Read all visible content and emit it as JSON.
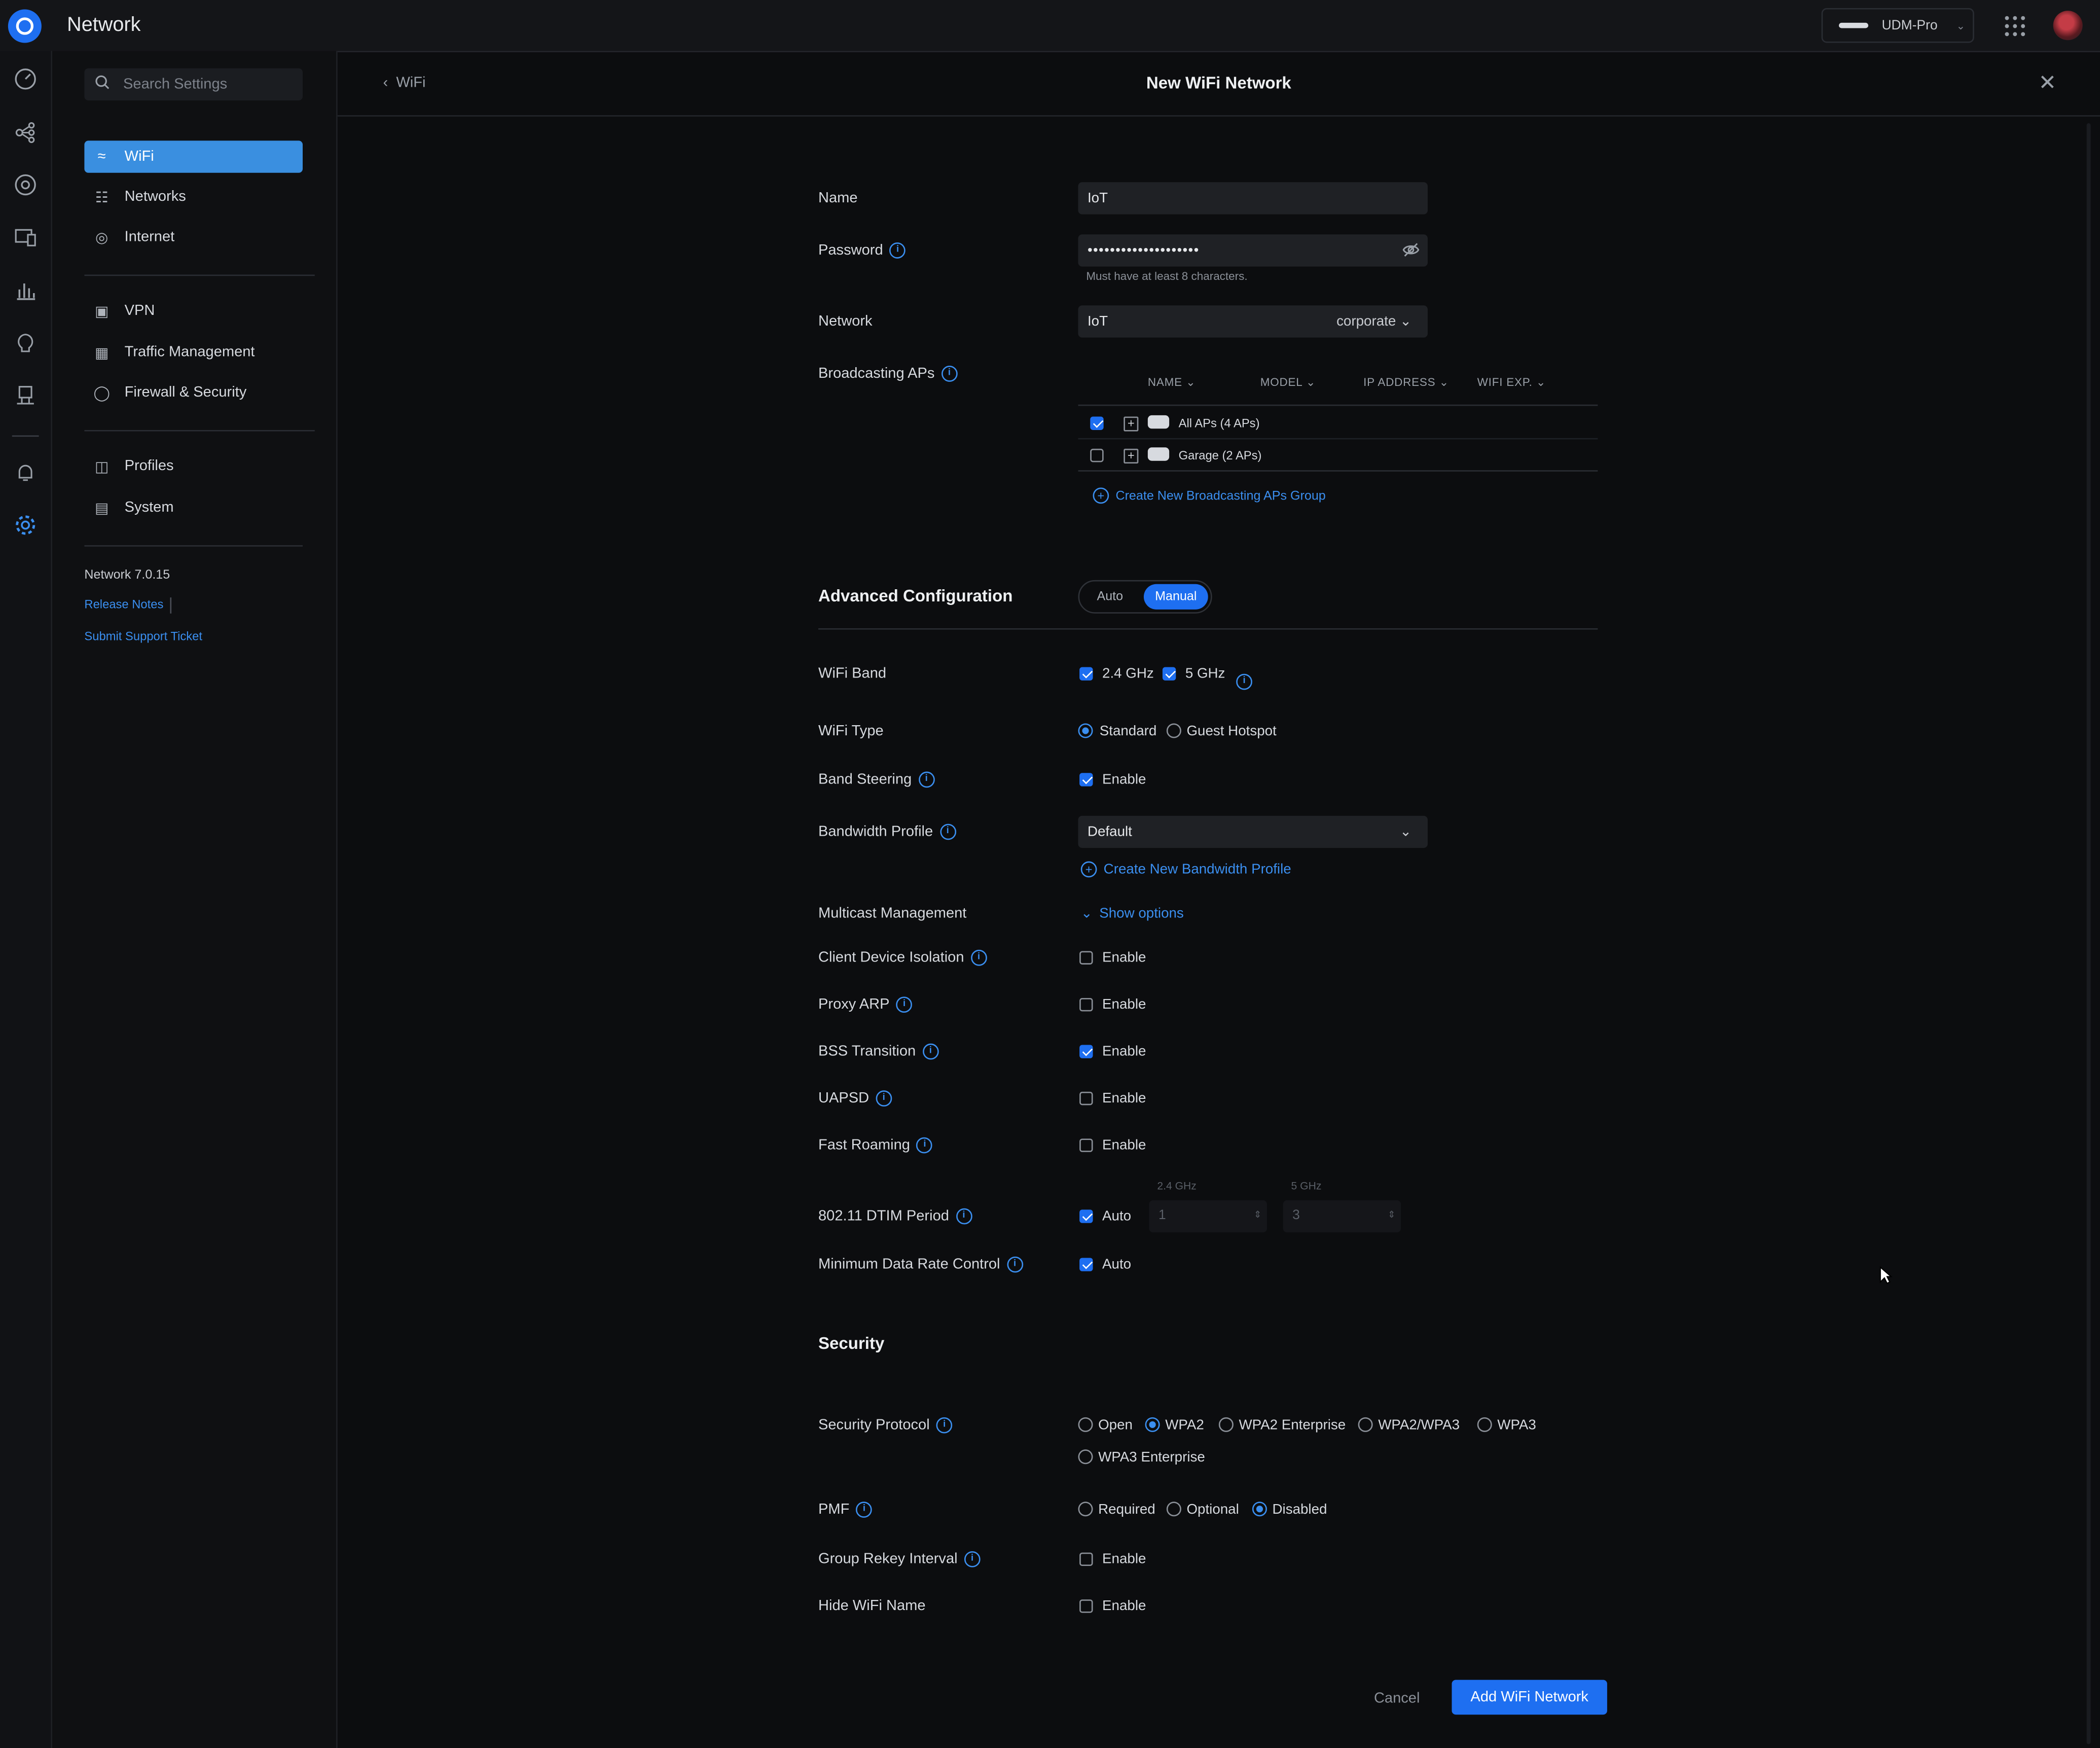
{
  "app": {
    "title": "Network"
  },
  "topbar": {
    "device": "UDM-Pro"
  },
  "sidebar": {
    "search_placeholder": "Search Settings",
    "items": [
      {
        "label": "WiFi"
      },
      {
        "label": "Networks"
      },
      {
        "label": "Internet"
      },
      {
        "label": "VPN"
      },
      {
        "label": "Traffic Management"
      },
      {
        "label": "Firewall & Security"
      },
      {
        "label": "Profiles"
      },
      {
        "label": "System"
      }
    ],
    "version": "Network 7.0.15",
    "release_notes": "Release Notes",
    "support": "Submit Support Ticket"
  },
  "header": {
    "back": "WiFi",
    "title": "New WiFi Network"
  },
  "form": {
    "name_label": "Name",
    "name_value": "IoT",
    "password_label": "Password",
    "password_value": "••••••••••••••••••••",
    "password_hint": "Must have at least 8 characters.",
    "network_label": "Network",
    "network_value": "IoT",
    "network_tag": "corporate",
    "broadcasting_label": "Broadcasting APs",
    "ap_table": {
      "headers": [
        "NAME",
        "MODEL",
        "IP ADDRESS",
        "WIFI EXP."
      ],
      "rows": [
        {
          "name": "All APs (4 APs)",
          "checked": true
        },
        {
          "name": "Garage (2 APs)",
          "checked": false
        }
      ],
      "create_group": "Create New Broadcasting APs Group"
    },
    "advanced": {
      "title": "Advanced Configuration",
      "auto": "Auto",
      "manual": "Manual"
    },
    "wifi_band": {
      "label": "WiFi Band",
      "opt1": "2.4 GHz",
      "opt2": "5 GHz"
    },
    "wifi_type": {
      "label": "WiFi Type",
      "opt1": "Standard",
      "opt2": "Guest Hotspot"
    },
    "band_steering": {
      "label": "Band Steering",
      "opt": "Enable"
    },
    "bandwidth_profile": {
      "label": "Bandwidth Profile",
      "value": "Default",
      "create": "Create New Bandwidth Profile"
    },
    "multicast": {
      "label": "Multicast Management",
      "show": "Show options"
    },
    "client_isolation": {
      "label": "Client Device Isolation",
      "opt": "Enable"
    },
    "proxy_arp": {
      "label": "Proxy ARP",
      "opt": "Enable"
    },
    "bss_transition": {
      "label": "BSS Transition",
      "opt": "Enable"
    },
    "uapsd": {
      "label": "UAPSD",
      "opt": "Enable"
    },
    "fast_roaming": {
      "label": "Fast Roaming",
      "opt": "Enable"
    },
    "dtim": {
      "label": "802.11 DTIM Period",
      "opt": "Auto",
      "band1": "2.4 GHz",
      "band2": "5 GHz",
      "val1": "1",
      "val2": "3"
    },
    "min_rate": {
      "label": "Minimum Data Rate Control",
      "opt": "Auto"
    },
    "security": {
      "title": "Security",
      "protocol_label": "Security Protocol",
      "protocols": [
        "Open",
        "WPA2",
        "WPA2 Enterprise",
        "WPA2/WPA3",
        "WPA3",
        "WPA3 Enterprise"
      ],
      "pmf_label": "PMF",
      "pmf": [
        "Required",
        "Optional",
        "Disabled"
      ],
      "rekey": {
        "label": "Group Rekey Interval",
        "opt": "Enable"
      },
      "hide_name": {
        "label": "Hide WiFi Name",
        "opt": "Enable"
      }
    },
    "cancel": "Cancel",
    "submit": "Add WiFi Network"
  },
  "colors": {
    "accent": "#1e6ff1",
    "link": "#3b8ff0",
    "bg": "#0c0d0f"
  }
}
